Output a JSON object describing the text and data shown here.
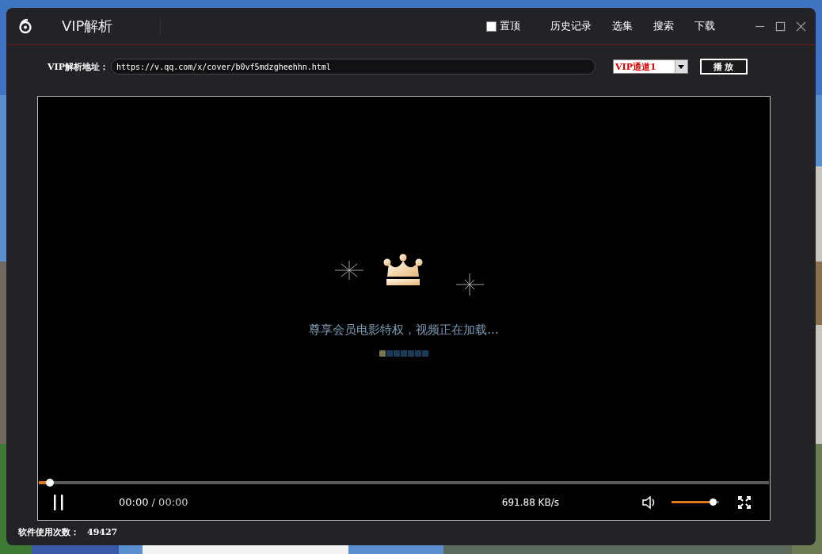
{
  "window": {
    "title": "VIP解析",
    "pin_on_top": {
      "label": "置顶",
      "checked": false
    },
    "menu": [
      "历史记录",
      "选集",
      "搜索",
      "下载"
    ]
  },
  "address": {
    "label": "VIP解析地址：",
    "value": "https://v.qq.com/x/cover/b0vf5mdzgheehhn.html"
  },
  "channel": {
    "value": "VIP通道1"
  },
  "play_button": "播 放",
  "player": {
    "message": "尊享会员电影特权，视频正在加载...",
    "loading_dots": [
      {
        "active": true
      },
      {
        "active": false
      },
      {
        "active": false
      },
      {
        "active": false
      },
      {
        "active": false
      },
      {
        "active": false
      },
      {
        "active": false
      }
    ],
    "progress": {
      "level": 0.01
    },
    "playing": true,
    "time_current": "00:00",
    "time_separator": "/",
    "time_total": "00:00",
    "speed": "691.88 KB/s",
    "volume": {
      "level": 0.94
    }
  },
  "status": {
    "label": "软件使用次数：",
    "value": "49427"
  }
}
